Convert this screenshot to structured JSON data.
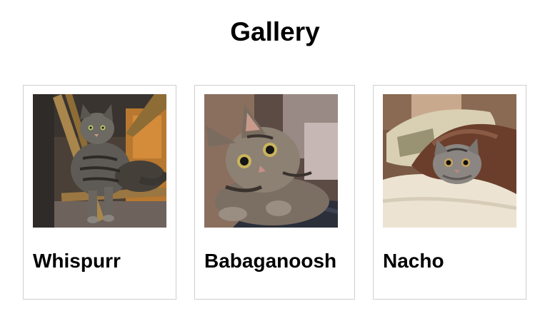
{
  "page": {
    "title": "Gallery"
  },
  "cards": [
    {
      "name": "Whispurr",
      "image_icon": "tabby-cat-on-chair-photo"
    },
    {
      "name": "Babaganoosh",
      "image_icon": "tabby-cat-closeup-photo"
    },
    {
      "name": "Nacho",
      "image_icon": "cat-under-blanket-photo"
    }
  ],
  "colors": {
    "background": "#ffffff",
    "card_border": "#cfcfcf",
    "text": "#000000"
  }
}
